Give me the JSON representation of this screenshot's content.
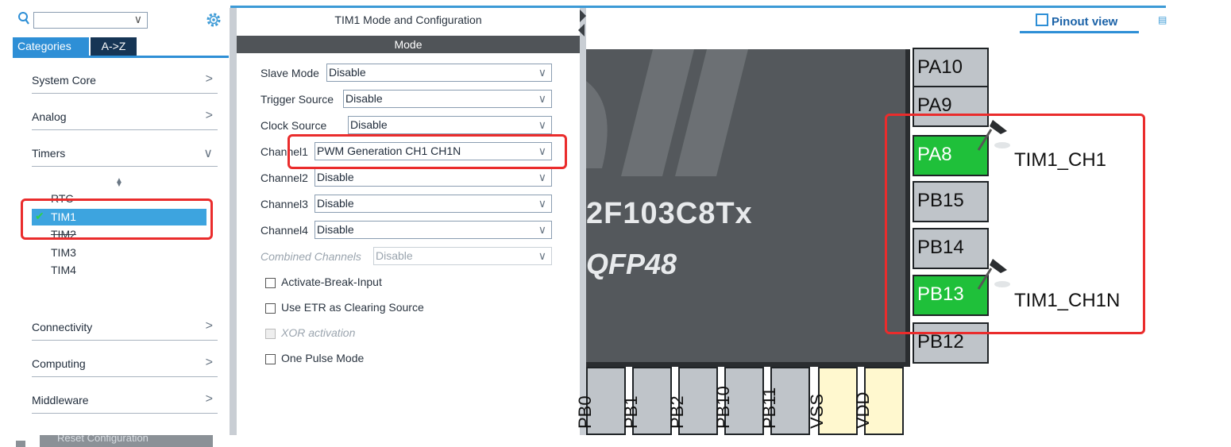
{
  "left_panel": {
    "search": {
      "value": ""
    },
    "tabs": {
      "categories": "Categories",
      "az": "A->Z"
    },
    "categories": [
      {
        "label": "System Core",
        "arrow": ">"
      },
      {
        "label": "Analog",
        "arrow": ">"
      },
      {
        "label": "Timers",
        "arrow": "∨"
      },
      {
        "label": "Connectivity",
        "arrow": ">"
      },
      {
        "label": "Computing",
        "arrow": ">"
      },
      {
        "label": "Middleware",
        "arrow": ">"
      }
    ],
    "timers": [
      "RTC",
      "TIM1",
      "TIM2",
      "TIM3",
      "TIM4"
    ],
    "selected_timer_check": "✔",
    "reset_button": "Reset Configuration"
  },
  "config_panel": {
    "title": "TIM1 Mode and Configuration",
    "section": "Mode",
    "fields": [
      {
        "label": "Slave Mode",
        "value": "Disable"
      },
      {
        "label": "Trigger Source",
        "value": "Disable"
      },
      {
        "label": "Clock Source",
        "value": "Disable"
      },
      {
        "label": "Channel1",
        "value": "PWM Generation CH1 CH1N"
      },
      {
        "label": "Channel2",
        "value": "Disable"
      },
      {
        "label": "Channel3",
        "value": "Disable"
      },
      {
        "label": "Channel4",
        "value": "Disable"
      },
      {
        "label": "Combined Channels",
        "value": "Disable"
      }
    ],
    "checkboxes": [
      {
        "label": "Activate-Break-Input",
        "checked": false,
        "enabled": true
      },
      {
        "label": "Use ETR as Clearing Source",
        "checked": false,
        "enabled": true
      },
      {
        "label": "XOR activation",
        "checked": false,
        "enabled": false
      },
      {
        "label": "One Pulse Mode",
        "checked": false,
        "enabled": true
      }
    ]
  },
  "pinout": {
    "view_button": "Pinout view",
    "chip_name": "2F103C8Tx",
    "package": "QFP48",
    "right_pins": [
      {
        "name": "PA10",
        "active": false
      },
      {
        "name": "PA9",
        "active": false
      },
      {
        "name": "PA8",
        "active": true
      },
      {
        "name": "PB15",
        "active": false
      },
      {
        "name": "PB14",
        "active": false
      },
      {
        "name": "PB13",
        "active": true
      },
      {
        "name": "PB12",
        "active": false
      }
    ],
    "signals": {
      "pa8": "TIM1_CH1",
      "pb13": "TIM1_CH1N"
    },
    "bottom_pins": [
      {
        "name": "PB0",
        "power": false
      },
      {
        "name": "PB1",
        "power": false
      },
      {
        "name": "PB2",
        "power": false
      },
      {
        "name": "PB10",
        "power": false
      },
      {
        "name": "PB11",
        "power": false
      },
      {
        "name": "VSS",
        "power": true
      },
      {
        "name": "VDD",
        "power": true
      }
    ],
    "colors": {
      "active_pin": "#1fc03a",
      "highlight": "#ea2c2c",
      "accent": "#2e8fd6"
    }
  }
}
